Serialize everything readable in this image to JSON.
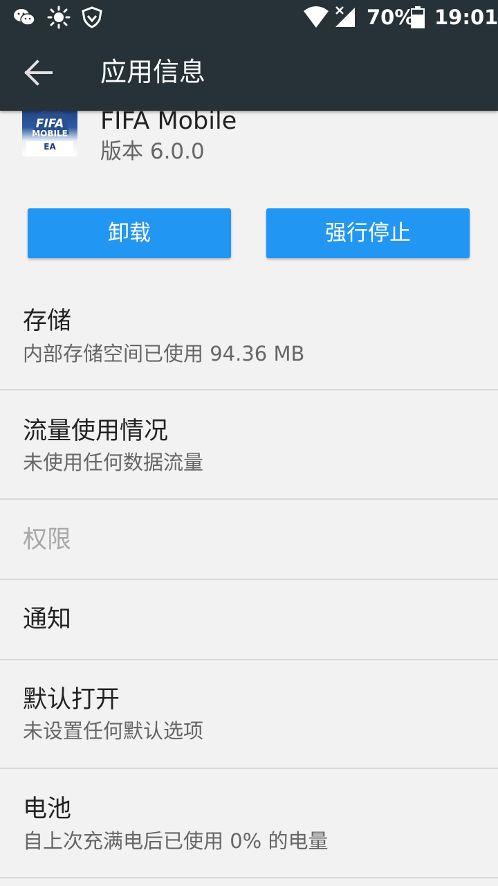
{
  "status_bar": {
    "icons": [
      "wechat-icon",
      "brightness-icon",
      "vpn-shield-icon",
      "wifi-icon",
      "signal-icon",
      "battery-icon"
    ],
    "battery": "70%",
    "time": "19:01"
  },
  "app_bar": {
    "title": "应用信息",
    "back_icon": "arrow-back-icon"
  },
  "app": {
    "name": "FIFA Mobile",
    "version": "版本 6.0.0",
    "icon_text_line1": "FIFA",
    "icon_text_line2": "MOBILE",
    "icon_badge": "EA"
  },
  "buttons": {
    "uninstall": "卸载",
    "force_stop": "强行停止"
  },
  "settings": [
    {
      "title": "存储",
      "subtitle": "内部存储空间已使用 94.36 MB",
      "enabled": true
    },
    {
      "title": "流量使用情况",
      "subtitle": "未使用任何数据流量",
      "enabled": true
    },
    {
      "title": "权限",
      "subtitle": "",
      "enabled": false
    },
    {
      "title": "通知",
      "subtitle": "",
      "enabled": true
    },
    {
      "title": "默认打开",
      "subtitle": "未设置任何默认选项",
      "enabled": true
    },
    {
      "title": "电池",
      "subtitle": "自上次充满电后已使用 0% 的电量",
      "enabled": true
    }
  ],
  "colors": {
    "bar": "#263238",
    "accent": "#2196f3",
    "background": "#f2f2f2"
  }
}
